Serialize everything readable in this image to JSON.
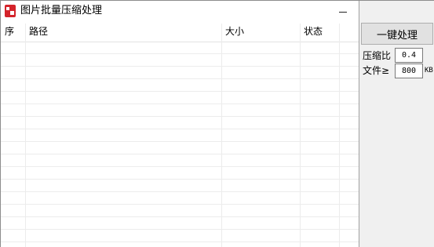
{
  "window": {
    "title": "图片批量压缩处理",
    "controls": {
      "minimize": "—",
      "maximize": "□",
      "close": "✕"
    }
  },
  "table": {
    "columns": [
      "序",
      "路径",
      "大小",
      "状态"
    ],
    "rows": []
  },
  "panel": {
    "process_button": "一键处理",
    "ratio_label": "压缩比",
    "ratio_value": "0.4",
    "file_label": "文件≥",
    "file_value": "800",
    "file_unit": "KB"
  },
  "icons": {
    "app": "app-icon",
    "minimize": "minimize-icon",
    "maximize": "maximize-icon",
    "close": "close-icon"
  },
  "colors": {
    "app_icon": "#d4232a",
    "panel_bg": "#f0f0f0",
    "grid_line": "#ececec",
    "button_bg": "#e1e1e1"
  }
}
